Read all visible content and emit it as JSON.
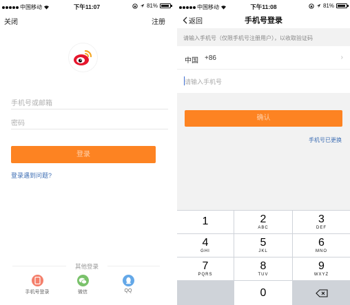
{
  "left": {
    "status": {
      "carrier": "中国移动",
      "time": "下午11:07",
      "battery": "81%"
    },
    "nav": {
      "close": "关闭",
      "register": "注册"
    },
    "fields": {
      "account_placeholder": "手机号或邮箱",
      "password_placeholder": "密码"
    },
    "login_button": "登录",
    "help_link": "登录遇到问题?",
    "other_login": {
      "title": "其他登录",
      "items": [
        {
          "label": "手机号登录",
          "icon": "phone-icon",
          "color": "#f47f6b"
        },
        {
          "label": "微信",
          "icon": "wechat-icon",
          "color": "#7ac26b"
        },
        {
          "label": "QQ",
          "icon": "qq-icon",
          "color": "#64a8e8"
        }
      ]
    }
  },
  "right": {
    "status": {
      "carrier": "中国移动",
      "time": "下午11:08",
      "battery": "81%"
    },
    "nav": {
      "back": "返回",
      "title": "手机号登录"
    },
    "hint": "请输入手机号（仅限手机号注册用户），以收取验证码",
    "country": {
      "name": "中国",
      "code": "+86"
    },
    "phone_placeholder": "请输入手机号",
    "confirm_button": "确认",
    "changed_link": "手机号已更换",
    "keypad": [
      {
        "num": "1",
        "letters": ""
      },
      {
        "num": "2",
        "letters": "ABC"
      },
      {
        "num": "3",
        "letters": "DEF"
      },
      {
        "num": "4",
        "letters": "GHI"
      },
      {
        "num": "5",
        "letters": "JKL"
      },
      {
        "num": "6",
        "letters": "MNO"
      },
      {
        "num": "7",
        "letters": "PQRS"
      },
      {
        "num": "8",
        "letters": "TUV"
      },
      {
        "num": "9",
        "letters": "WXYZ"
      },
      {
        "num": "0",
        "letters": ""
      }
    ]
  },
  "colors": {
    "accent": "#fd8322",
    "link": "#3f6fb4",
    "brand_red": "#e6162d"
  }
}
